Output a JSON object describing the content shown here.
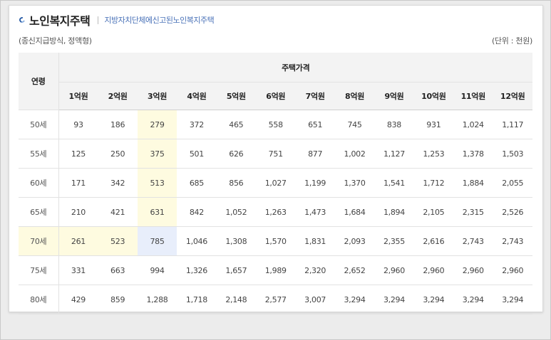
{
  "header": {
    "title": "노인복지주택",
    "subtitle": "지방자치단체에신고된노인복지주택"
  },
  "notes": {
    "left": "(종신지급방식, 정액형)",
    "right": "(단위 : 천원)"
  },
  "table": {
    "age_header": "연령",
    "group_header": "주택가격",
    "columns": [
      "1억원",
      "2억원",
      "3억원",
      "4억원",
      "5억원",
      "6억원",
      "7억원",
      "8억원",
      "9억원",
      "10억원",
      "11억원",
      "12억원"
    ],
    "rows": [
      {
        "age": "50세",
        "values": [
          "93",
          "186",
          "279",
          "372",
          "465",
          "558",
          "651",
          "745",
          "838",
          "931",
          "1,024",
          "1,117"
        ]
      },
      {
        "age": "55세",
        "values": [
          "125",
          "250",
          "375",
          "501",
          "626",
          "751",
          "877",
          "1,002",
          "1,127",
          "1,253",
          "1,378",
          "1,503"
        ]
      },
      {
        "age": "60세",
        "values": [
          "171",
          "342",
          "513",
          "685",
          "856",
          "1,027",
          "1,199",
          "1,370",
          "1,541",
          "1,712",
          "1,884",
          "2,055"
        ]
      },
      {
        "age": "65세",
        "values": [
          "210",
          "421",
          "631",
          "842",
          "1,052",
          "1,263",
          "1,473",
          "1,684",
          "1,894",
          "2,105",
          "2,315",
          "2,526"
        ]
      },
      {
        "age": "70세",
        "values": [
          "261",
          "523",
          "785",
          "1,046",
          "1,308",
          "1,570",
          "1,831",
          "2,093",
          "2,355",
          "2,616",
          "2,743",
          "2,743"
        ]
      },
      {
        "age": "75세",
        "values": [
          "331",
          "663",
          "994",
          "1,326",
          "1,657",
          "1,989",
          "2,320",
          "2,652",
          "2,960",
          "2,960",
          "2,960",
          "2,960"
        ]
      },
      {
        "age": "80세",
        "values": [
          "429",
          "859",
          "1,288",
          "1,718",
          "2,148",
          "2,577",
          "3,007",
          "3,294",
          "3,294",
          "3,294",
          "3,294",
          "3,294"
        ]
      }
    ],
    "highlight": {
      "column_index": 2,
      "row_index": 4
    },
    "colors": {
      "highlight": "#fefbe0",
      "intersection": "#e8eefb",
      "header_bg": "#f3f3f3"
    }
  }
}
